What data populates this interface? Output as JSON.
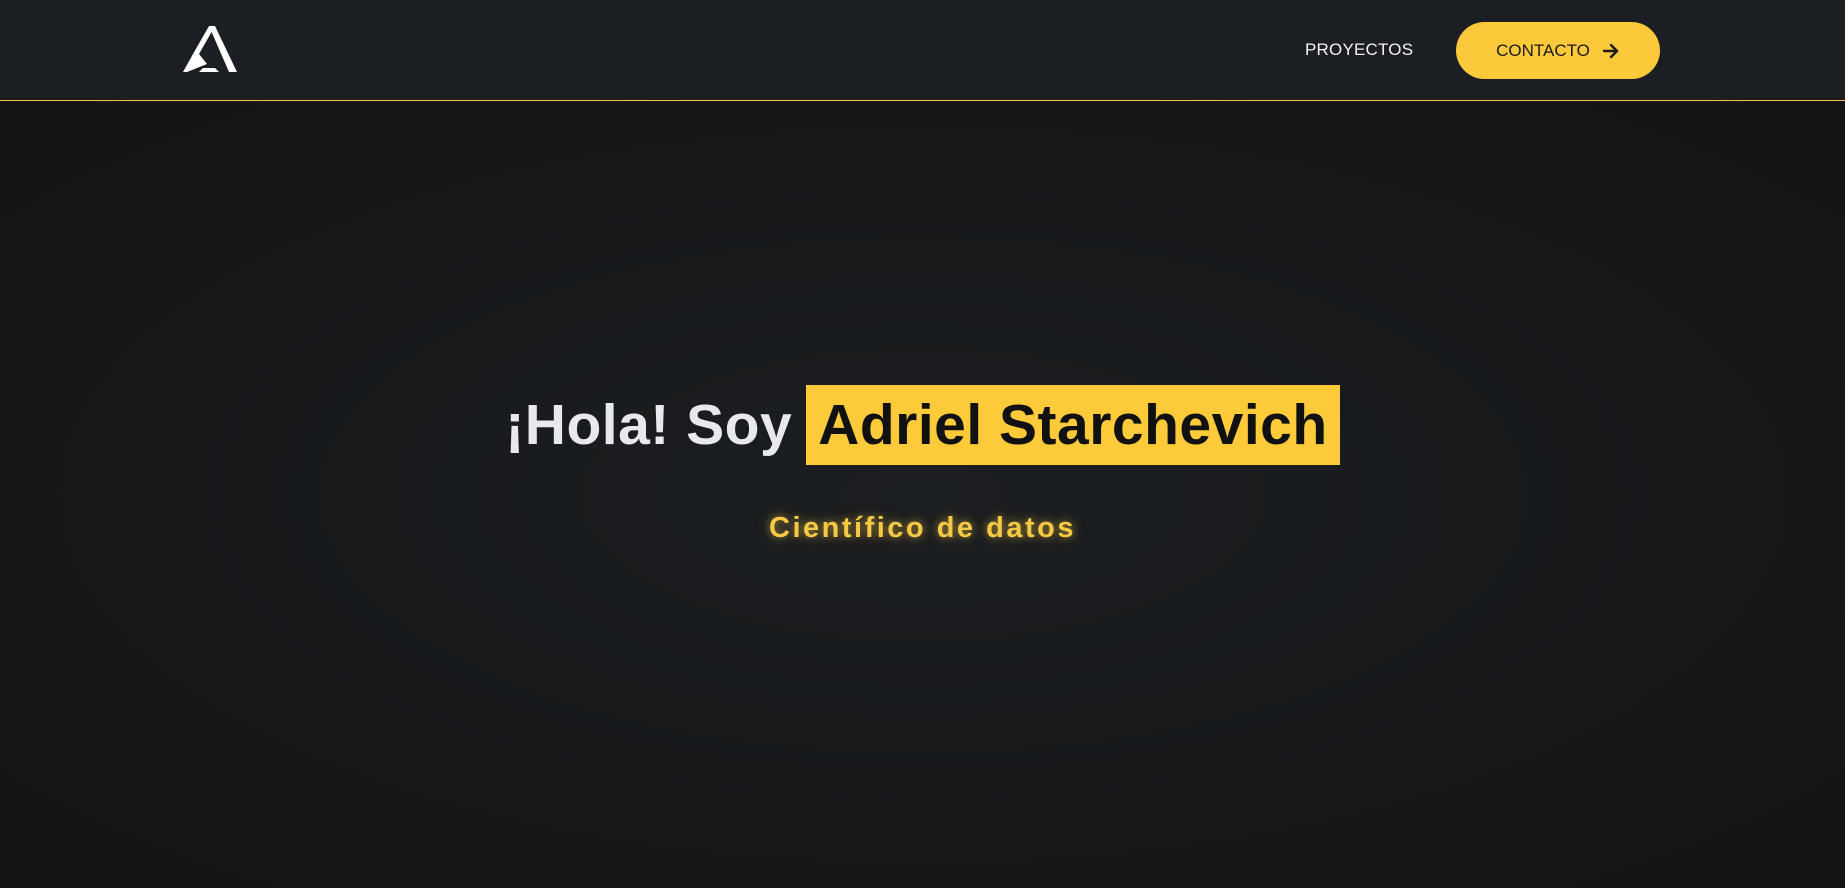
{
  "header": {
    "logo_icon": "stylized-a-logo-icon",
    "nav": {
      "projects_label": "PROYECTOS",
      "contact_label": "CONTACTO",
      "contact_icon": "arrow-right-icon"
    }
  },
  "hero": {
    "greeting": "¡Hola! Soy",
    "name": "Adriel Starchevich",
    "subtitle": "Científico de datos"
  },
  "colors": {
    "accent": "#fcc93a",
    "header_bg": "#1b1e22",
    "page_bg": "#151719",
    "text_light": "#e8e9ec"
  }
}
